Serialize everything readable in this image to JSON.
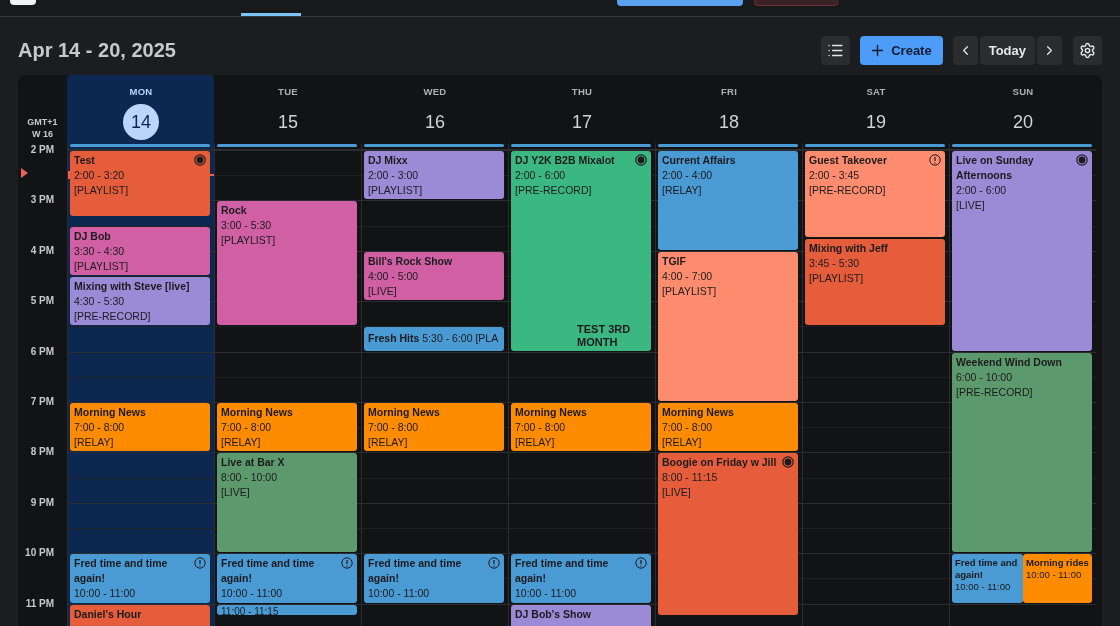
{
  "header": {
    "title": "Apr 14 - 20, 2025",
    "create_label": "Create",
    "today_label": "Today"
  },
  "gutter": {
    "timezone": "GMT+1",
    "week": "W 16",
    "hours": [
      "2 PM",
      "3 PM",
      "4 PM",
      "5 PM",
      "6 PM",
      "7 PM",
      "8 PM",
      "9 PM",
      "10 PM",
      "11 PM"
    ]
  },
  "days": [
    {
      "name": "MON",
      "date": "14",
      "selected": true,
      "now_indicator": true,
      "events": [
        {
          "kind": "stub",
          "color": "#4a9ad4"
        },
        {
          "kind": "event",
          "title": "Test",
          "time": "2:00 - 3:20",
          "tag": "[PLAYLIST]",
          "color": "#e55d3b",
          "recording": true
        },
        {
          "kind": "event",
          "title": "DJ Bob",
          "time": "3:30 - 4:30",
          "tag": "[PLAYLIST]",
          "color": "#d05fa3"
        },
        {
          "kind": "event",
          "title": "Mixing with Steve [live]",
          "time": "4:30 - 5:30",
          "tag": "[PRE-RECORD]",
          "color": "#9b8ad6"
        },
        {
          "kind": "event",
          "title": "Morning News",
          "time": "7:00 - 8:00",
          "tag": "[RELAY]",
          "color": "#ff8c00"
        },
        {
          "kind": "event",
          "title": "Fred time and time again!",
          "time": "10:00 - 11:00",
          "color": "#4a9ad4",
          "warning": true
        },
        {
          "kind": "event",
          "title": "Daniel's Hour",
          "color": "#e55d3b"
        }
      ]
    },
    {
      "name": "TUE",
      "date": "15",
      "selected": false,
      "events": [
        {
          "kind": "stub",
          "color": "#4a9ad4"
        },
        {
          "kind": "event",
          "title": "Rock",
          "time": "3:00 - 5:30",
          "tag": "[PLAYLIST]",
          "color": "#d05fa3"
        },
        {
          "kind": "event",
          "title": "Morning News",
          "time": "7:00 - 8:00",
          "tag": "[RELAY]",
          "color": "#ff8c00"
        },
        {
          "kind": "event",
          "title": "Live at Bar X",
          "time": "8:00 - 10:00",
          "tag": "[LIVE]",
          "color": "#5c9a6e"
        },
        {
          "kind": "event",
          "title": "Fred time and time again!",
          "time": "10:00 - 11:00",
          "color": "#4a9ad4",
          "warning": true
        },
        {
          "kind": "event",
          "time": "11:00 - 11:15",
          "color": "#4a9ad4"
        }
      ]
    },
    {
      "name": "WED",
      "date": "16",
      "selected": false,
      "events": [
        {
          "kind": "stub",
          "color": "#4a9ad4"
        },
        {
          "kind": "event",
          "title": "DJ Mixx",
          "time": "2:00 - 3:00",
          "tag": "[PLAYLIST]",
          "color": "#9b8ad6"
        },
        {
          "kind": "event",
          "title": "Bill's Rock Show",
          "time": "4:00 - 5:00",
          "tag": "[LIVE]",
          "color": "#d05fa3"
        },
        {
          "kind": "event",
          "title": "Fresh Hits",
          "time": "5:30 - 6:00",
          "tag": "[PLA",
          "color": "#4a9ad4"
        },
        {
          "kind": "event",
          "title": "Morning News",
          "time": "7:00 - 8:00",
          "tag": "[RELAY]",
          "color": "#ff8c00"
        },
        {
          "kind": "event",
          "title": "Fred time and time again!",
          "time": "10:00 - 11:00",
          "color": "#4a9ad4",
          "warning": true
        }
      ]
    },
    {
      "name": "THU",
      "date": "17",
      "selected": false,
      "events": [
        {
          "kind": "stub",
          "color": "#4a9ad4"
        },
        {
          "kind": "event",
          "title": "DJ Y2K B2B Mixalot",
          "time": "2:00 - 6:00",
          "tag": "[PRE-RECORD]",
          "color": "#3bb782",
          "recording": true,
          "overlay_title": "TEST 3RD MONTH"
        },
        {
          "kind": "event",
          "title": "Morning News",
          "time": "7:00 - 8:00",
          "tag": "[RELAY]",
          "color": "#ff8c00"
        },
        {
          "kind": "event",
          "title": "Fred time and time again!",
          "time": "10:00 - 11:00",
          "color": "#4a9ad4",
          "warning": true
        },
        {
          "kind": "event",
          "title": "DJ Bob's Show",
          "color": "#9b8ad6"
        }
      ]
    },
    {
      "name": "FRI",
      "date": "18",
      "selected": false,
      "events": [
        {
          "kind": "stub",
          "color": "#4a9ad4"
        },
        {
          "kind": "event",
          "title": "Current Affairs",
          "time": "2:00 - 4:00",
          "tag": "[RELAY]",
          "color": "#4a9ad4"
        },
        {
          "kind": "event",
          "title": "TGIF",
          "time": "4:00 - 7:00",
          "tag": "[PLAYLIST]",
          "color": "#ff8c6e"
        },
        {
          "kind": "event",
          "title": "Morning News",
          "time": "7:00 - 8:00",
          "tag": "[RELAY]",
          "color": "#ff8c00"
        },
        {
          "kind": "event",
          "title": "Boogie on Friday w Jill",
          "time": "8:00 - 11:15",
          "tag": "[LIVE]",
          "color": "#e55d3b",
          "recording": true
        }
      ]
    },
    {
      "name": "SAT",
      "date": "19",
      "selected": false,
      "events": [
        {
          "kind": "stub",
          "color": "#4a9ad4"
        },
        {
          "kind": "event",
          "title": "Guest Takeover",
          "time": "2:00 - 3:45",
          "tag": "[PRE-RECORD]",
          "color": "#ff8c6e",
          "warning": true
        },
        {
          "kind": "event",
          "title": "Mixing with Jeff",
          "time": "3:45 - 5:30",
          "tag": "[PLAYLIST]",
          "color": "#e55d3b"
        }
      ]
    },
    {
      "name": "SUN",
      "date": "20",
      "selected": false,
      "events": [
        {
          "kind": "stub",
          "color": "#4a9ad4"
        },
        {
          "kind": "event",
          "title": "Live on Sunday Afternoons",
          "time": "2:00 - 6:00",
          "tag": "[LIVE]",
          "color": "#9b8ad6",
          "recording": true
        },
        {
          "kind": "event",
          "title": "Weekend Wind Down",
          "time": "6:00 - 10:00",
          "tag": "[PRE-RECORD]",
          "color": "#5c9a6e"
        },
        {
          "kind": "event",
          "title": "Fred time and again!",
          "time": "10:00 - 11:00",
          "color": "#4a9ad4",
          "shares_slot": true
        },
        {
          "kind": "event",
          "title": "Morning rides",
          "time": "10:00 - 11:00",
          "color": "#ff8c00",
          "shares_slot": true
        }
      ]
    }
  ]
}
